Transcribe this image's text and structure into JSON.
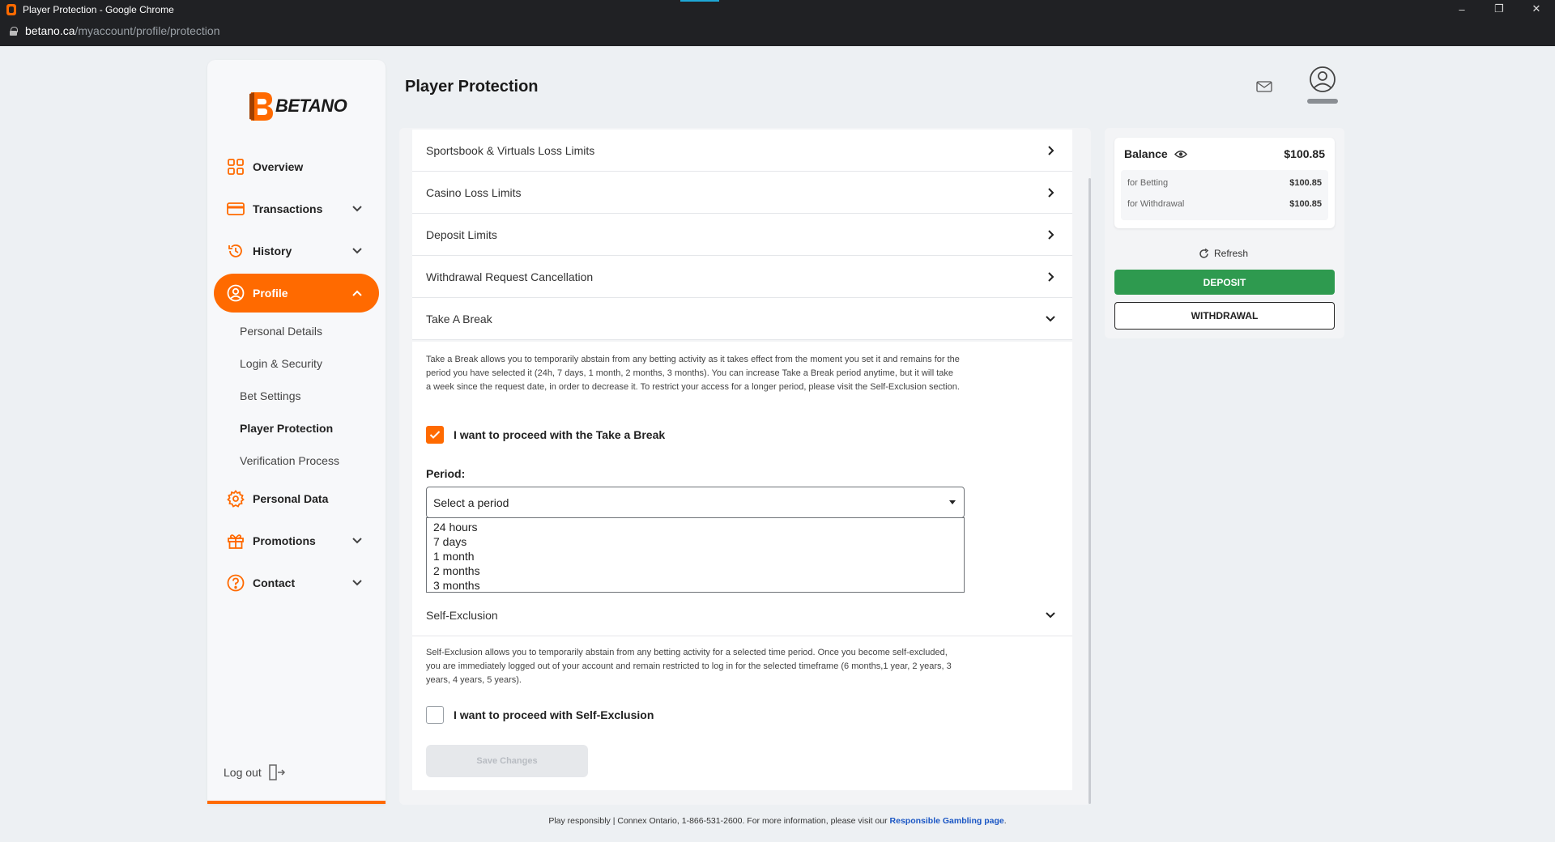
{
  "browser": {
    "window_title": "Player Protection - Google Chrome",
    "url_domain": "betano.ca",
    "url_path": "/myaccount/profile/protection",
    "controls": {
      "minimize": "–",
      "restore": "❐",
      "close": "✕"
    }
  },
  "brand": {
    "name": "BETANO",
    "accent": "#ff6a00"
  },
  "sidebar": {
    "items": [
      {
        "label": "Overview",
        "icon": "grid-icon"
      },
      {
        "label": "Transactions",
        "icon": "card-icon"
      },
      {
        "label": "History",
        "icon": "history-icon"
      },
      {
        "label": "Profile",
        "icon": "user-circle-icon"
      },
      {
        "label": "Personal Data",
        "icon": "gear-icon"
      },
      {
        "label": "Promotions",
        "icon": "gift-icon"
      },
      {
        "label": "Contact",
        "icon": "help-icon"
      }
    ],
    "profile_sub": [
      "Personal Details",
      "Login & Security",
      "Bet Settings",
      "Player Protection",
      "Verification Process"
    ],
    "logout": "Log out"
  },
  "header": {
    "title": "Player Protection"
  },
  "protection": {
    "rows": [
      "Sportsbook & Virtuals Loss Limits",
      "Casino Loss Limits",
      "Deposit Limits",
      "Withdrawal Request Cancellation",
      "Take A Break"
    ],
    "take_break": {
      "description": "Take a Break allows you to temporarily abstain from any betting activity as it takes effect from the moment you set it and remains for the period you have selected it (24h, 7 days, 1 month, 2 months, 3 months). You can increase Take a Break period anytime, but it will take a week since the request date, in order to decrease it. To restrict your access for a longer period, please visit the Self-Exclusion section.",
      "checkbox_label": "I want to proceed with the Take a Break",
      "checked": true,
      "period_label": "Period:",
      "select_placeholder": "Select a period",
      "options": [
        "24 hours",
        "7 days",
        "1 month",
        "2 months",
        "3 months"
      ]
    },
    "self_exclusion": {
      "title": "Self-Exclusion",
      "description": "Self-Exclusion allows you to temporarily abstain from any betting activity for a selected time period. Once you become self-excluded, you are immediately logged out of your account and remain restricted to log in for the selected timeframe (6 months,1 year, 2 years, 3 years, 4 years, 5 years).",
      "checkbox_label": "I want to proceed with Self-Exclusion",
      "checked": false,
      "save_label": "Save Changes"
    }
  },
  "balance": {
    "label": "Balance",
    "total": "$100.85",
    "betting_label": "for Betting",
    "betting_value": "$100.85",
    "withdrawal_label": "for Withdrawal",
    "withdrawal_value": "$100.85",
    "refresh": "Refresh",
    "deposit": "DEPOSIT",
    "withdrawal": "WITHDRAWAL",
    "deposit_color": "#2e9a4f"
  },
  "footer": {
    "text": "Play responsibly | Connex Ontario, 1-866-531-2600. For more information, please visit our ",
    "link": "Responsible Gambling page",
    "suffix": "."
  }
}
